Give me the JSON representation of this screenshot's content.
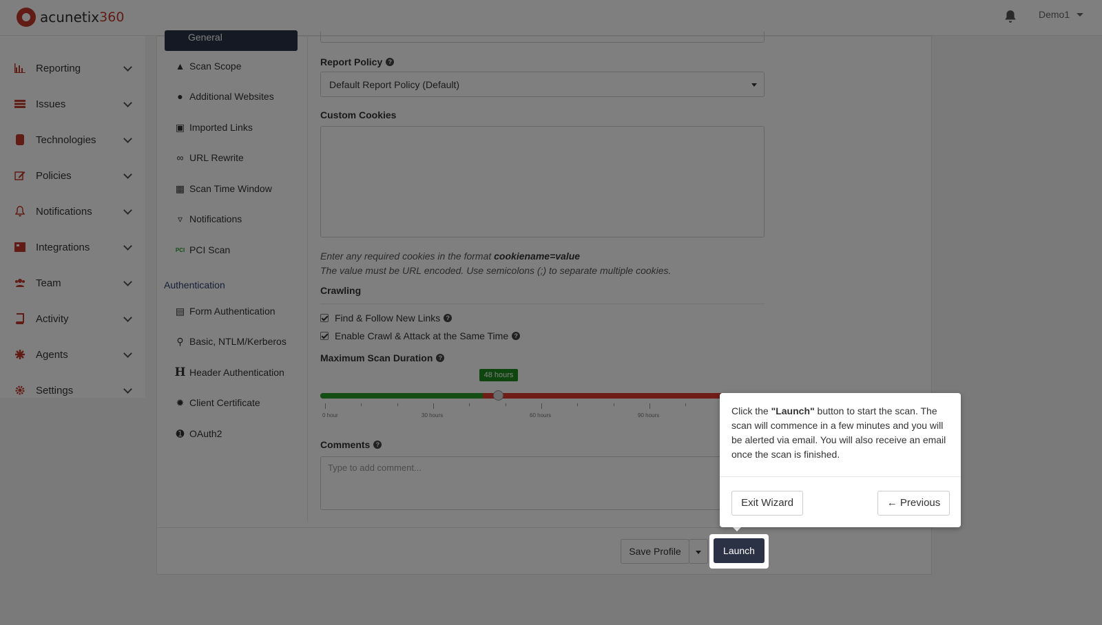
{
  "app": {
    "logo_text": "acunetix",
    "logo_number": "360",
    "user": "Demo1"
  },
  "sidebar": {
    "items": [
      {
        "label": "Reporting",
        "icon": "bar-chart-icon"
      },
      {
        "label": "Issues",
        "icon": "list-icon"
      },
      {
        "label": "Technologies",
        "icon": "database-icon"
      },
      {
        "label": "Policies",
        "icon": "edit-icon"
      },
      {
        "label": "Notifications",
        "icon": "bell-icon"
      },
      {
        "label": "Integrations",
        "icon": "puzzle-icon"
      },
      {
        "label": "Team",
        "icon": "users-icon"
      },
      {
        "label": "Activity",
        "icon": "book-icon"
      },
      {
        "label": "Agents",
        "icon": "asterisk-icon"
      },
      {
        "label": "Settings",
        "icon": "gear-icon"
      }
    ]
  },
  "subnav": {
    "active": "General",
    "items": [
      {
        "label": "Scan Scope",
        "icon": "sitemap-icon"
      },
      {
        "label": "Additional Websites",
        "icon": "globe-icon"
      },
      {
        "label": "Imported Links",
        "icon": "import-icon"
      },
      {
        "label": "URL Rewrite",
        "icon": "link-icon"
      },
      {
        "label": "Scan Time Window",
        "icon": "calendar-icon"
      },
      {
        "label": "Notifications",
        "icon": "bell-icon"
      },
      {
        "label": "PCI Scan",
        "icon": "pci-icon"
      }
    ],
    "auth_heading": "Authentication",
    "auth_items": [
      {
        "label": "Form Authentication",
        "icon": "form-icon"
      },
      {
        "label": "Basic, NTLM/Kerberos",
        "icon": "key-icon"
      },
      {
        "label": "Header Authentication",
        "icon": "header-h-icon"
      },
      {
        "label": "Client Certificate",
        "icon": "certificate-icon"
      },
      {
        "label": "OAuth2",
        "icon": "oauth-icon"
      }
    ]
  },
  "form": {
    "report_policy_label": "Report Policy",
    "report_policy_value": "Default Report Policy (Default)",
    "custom_cookies_label": "Custom Cookies",
    "cookies_hint_prefix": "Enter any required cookies in the format ",
    "cookies_hint_format": "cookiename=value",
    "cookies_hint_line2": "The value must be URL encoded. Use semicolons (;) to separate multiple cookies.",
    "crawling_label": "Crawling",
    "find_follow_label": "Find & Follow New Links",
    "crawl_attack_label": "Enable Crawl & Attack at the Same Time",
    "max_duration_label": "Maximum Scan Duration",
    "duration_value_label": "48 hours",
    "duration_fraction": 0.4,
    "tick_labels": [
      "0 hour",
      "30 hours",
      "60 hours",
      "90 hours"
    ],
    "comments_label": "Comments",
    "comments_placeholder": "Type to add comment..."
  },
  "footer": {
    "save_profile": "Save Profile",
    "launch": "Launch"
  },
  "wizard": {
    "text_prefix": "Click the ",
    "text_bold": "\"Launch\"",
    "text_suffix": " button to start the scan. The scan will commence in a few minutes and you will be alerted via email. You will also receive an email once the scan is finished.",
    "exit_label": "Exit Wizard",
    "previous_label": "← Previous"
  }
}
